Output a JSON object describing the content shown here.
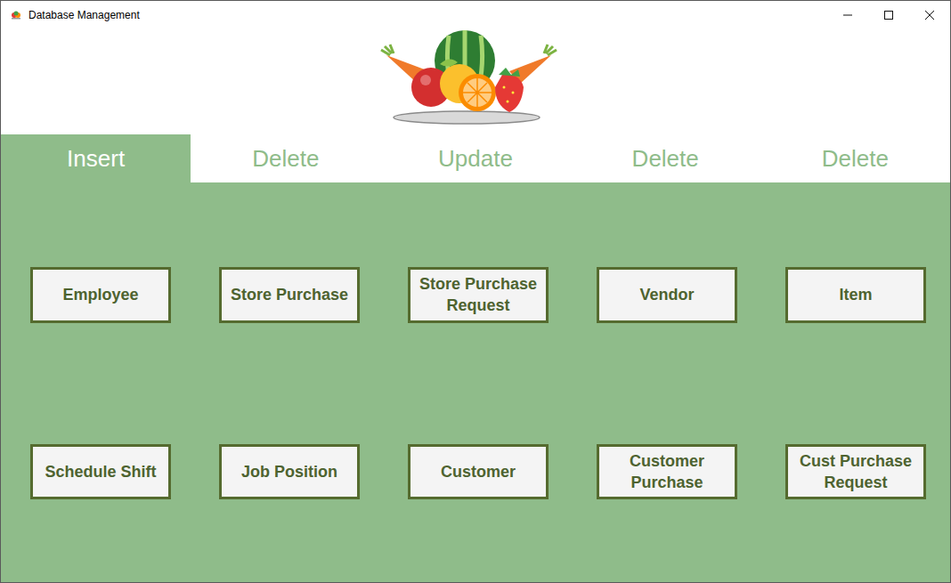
{
  "window": {
    "title": "Database Management"
  },
  "tabs": [
    {
      "label": "Insert",
      "selected": true
    },
    {
      "label": "Delete",
      "selected": false
    },
    {
      "label": "Update",
      "selected": false
    },
    {
      "label": "Delete",
      "selected": false
    },
    {
      "label": "Delete",
      "selected": false
    }
  ],
  "buttons": [
    "Employee",
    "Store Purchase",
    "Store Purchase Request",
    "Vendor",
    "Item",
    "Schedule Shift",
    "Job Position",
    "Customer",
    "Customer Purchase",
    "Cust Purchase Request"
  ]
}
